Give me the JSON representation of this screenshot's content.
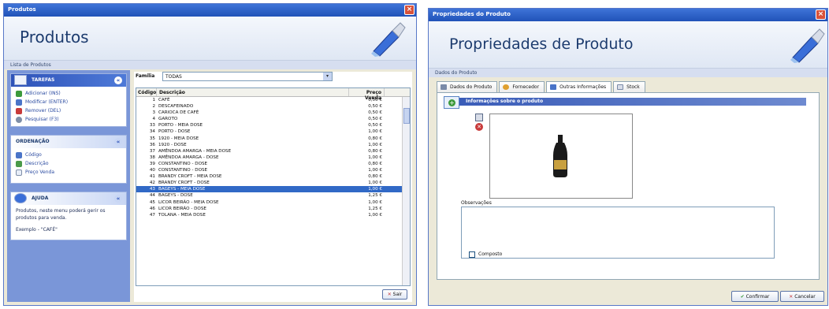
{
  "left_window": {
    "title": "Produtos",
    "header_title": "Produtos",
    "subheader": "Lista de Produtos",
    "tarefas": {
      "title": "TAREFAS",
      "items": [
        "Adicionar (INS)",
        "Modificar (ENTER)",
        "Remover (DEL)",
        "Pesquisar (F3)"
      ]
    },
    "ordenacao": {
      "title": "ORDENAÇÃO",
      "items": [
        "Código",
        "Descrição",
        "Preço Venda"
      ]
    },
    "ajuda": {
      "title": "AJUDA",
      "text": "Produtos, neste menu poderá gerir os produtos para venda.",
      "example": "Exemplo - \"CAFÉ\""
    },
    "familia_label": "Família",
    "familia_value": "TODAS",
    "columns": [
      "Código",
      "Descrição",
      "Preço Venda"
    ],
    "rows": [
      [
        "1",
        "CAFÉ",
        "0,50 €"
      ],
      [
        "2",
        "DESCAFEINADO",
        "0,50 €"
      ],
      [
        "3",
        "CARIOCA DE CAFÉ",
        "0,50 €"
      ],
      [
        "4",
        "GAROTO",
        "0,50 €"
      ],
      [
        "33",
        "PORTO - MEIA DOSE",
        "0,50 €"
      ],
      [
        "34",
        "PORTO - DOSE",
        "1,00 €"
      ],
      [
        "35",
        "1920 - MEIA DOSE",
        "0,80 €"
      ],
      [
        "36",
        "1920 - DOSE",
        "1,00 €"
      ],
      [
        "37",
        "AMÊNDOA AMARGA - MEIA DOSE",
        "0,80 €"
      ],
      [
        "38",
        "AMÊNDOA AMARGA - DOSE",
        "1,00 €"
      ],
      [
        "39",
        "CONSTANTINO - DOSE",
        "0,80 €"
      ],
      [
        "40",
        "CONSTANTINO - DOSE",
        "1,00 €"
      ],
      [
        "41",
        "BRANDY CROFT - MEIA DOSE",
        "0,80 €"
      ],
      [
        "42",
        "BRANDY CROFT - DOSE",
        "1,00 €"
      ],
      [
        "43",
        "BAGEYS - MEIA DOSE",
        "1,00 €"
      ],
      [
        "44",
        "BAGEYS - DOSE",
        "1,25 €"
      ],
      [
        "45",
        "LICOR BEIRÃO - MEIA DOSE",
        "1,00 €"
      ],
      [
        "46",
        "LICOR BEIRÃO - DOSE",
        "1,25 €"
      ],
      [
        "47",
        "TOLANA - MEIA DOSE",
        "1,00 €"
      ]
    ],
    "selected_row": 14,
    "close_label": "Sair"
  },
  "right_window": {
    "title": "Propriedades do Produto",
    "header_title": "Propriedades de Produto",
    "subheader": "Dados do Produto",
    "tabs": [
      "Dados do Produto",
      "Fornecedor",
      "Outras Informações",
      "Stock"
    ],
    "active_tab": 2,
    "info_bar": "Informações sobre o produto",
    "observacoes_label": "Observações",
    "composto_label": "Composto",
    "confirm_label": "Confirmar",
    "cancel_label": "Cancelar"
  },
  "colors": {
    "title_bar": "#2a5cc2",
    "selection": "#3169c6",
    "header_text": "#1c3b6e"
  }
}
